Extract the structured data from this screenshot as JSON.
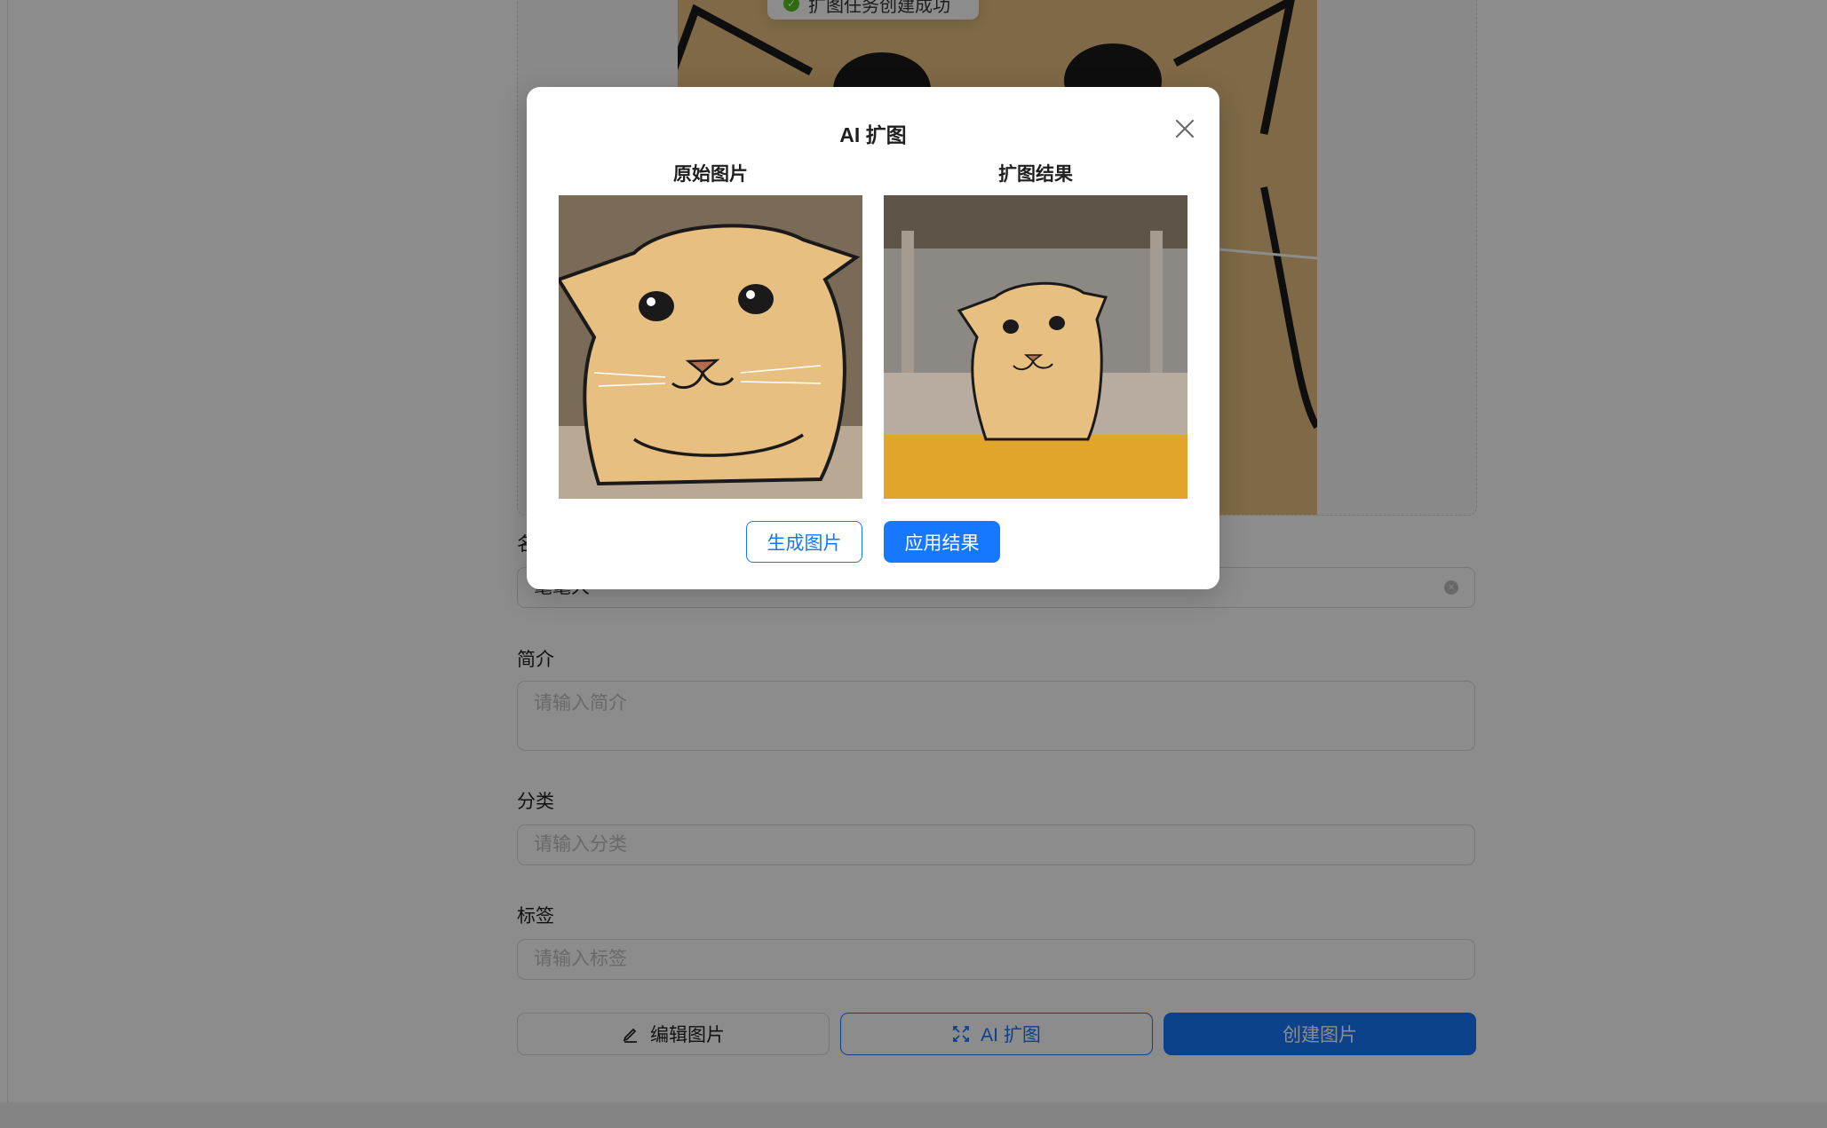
{
  "toast": {
    "text": "扩图任务创建成功"
  },
  "form": {
    "name": {
      "label": "名称",
      "value": "耄耄大"
    },
    "intro": {
      "label": "简介",
      "placeholder": "请输入简介"
    },
    "category": {
      "label": "分类",
      "placeholder": "请输入分类"
    },
    "tags": {
      "label": "标签",
      "placeholder": "请输入标签"
    }
  },
  "actions": {
    "edit_label": "编辑图片",
    "ai_label": "AI 扩图",
    "create_label": "创建图片"
  },
  "modal": {
    "title": "AI 扩图",
    "original_label": "原始图片",
    "result_label": "扩图结果",
    "generate_label": "生成图片",
    "apply_label": "应用结果"
  },
  "colors": {
    "primary": "#1677ff",
    "mask": "rgba(0,0,0,0.45)",
    "cat_fur": "#e7bf80",
    "cat_outline": "#1a1a1a",
    "result_bowl": "#e0a52a"
  },
  "icons": {
    "edit": "edit-pen-icon",
    "ai": "expand-arrows-icon",
    "close": "close-icon",
    "clear": "clear-circle-icon",
    "toast": "check-circle-icon"
  }
}
